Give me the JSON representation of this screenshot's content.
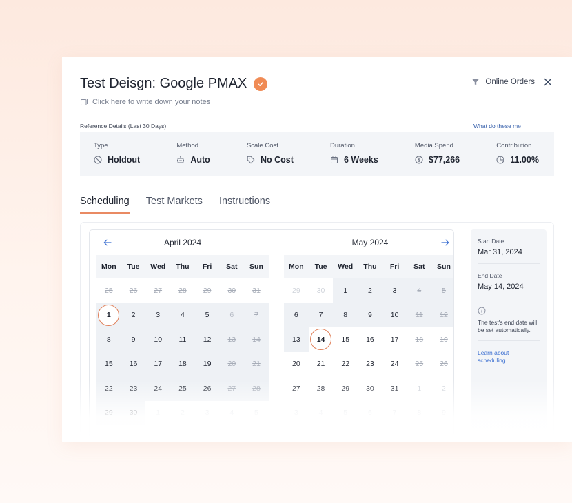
{
  "header": {
    "title": "Test Deisgn: Google PMAX",
    "notes_prompt": "Click here to write down your notes",
    "filter_label": "Online Orders"
  },
  "reference": {
    "label": "Reference Details (Last 30 Days)",
    "link": "What do these me",
    "stats": [
      {
        "label": "Type",
        "value": "Holdout",
        "icon": "ban-icon"
      },
      {
        "label": "Method",
        "value": "Auto",
        "icon": "robot-icon"
      },
      {
        "label": "Scale Cost",
        "value": "No Cost",
        "icon": "tag-icon"
      },
      {
        "label": "Duration",
        "value": "6 Weeks",
        "icon": "calendar-icon"
      },
      {
        "label": "Media Spend",
        "value": "$77,266",
        "icon": "dollar-icon"
      },
      {
        "label": "Contribution",
        "value": "11.00%",
        "icon": "pie-icon"
      }
    ]
  },
  "tabs": [
    {
      "label": "Scheduling",
      "active": true
    },
    {
      "label": "Test Markets",
      "active": false
    },
    {
      "label": "Instructions",
      "active": false
    }
  ],
  "calendar": {
    "weekdays": [
      "Mon",
      "Tue",
      "Wed",
      "Thu",
      "Fri",
      "Sat",
      "Sun"
    ],
    "months": [
      {
        "title": "April 2024",
        "days": [
          {
            "d": "25",
            "s": "struck"
          },
          {
            "d": "26",
            "s": "struck"
          },
          {
            "d": "27",
            "s": "struck"
          },
          {
            "d": "28",
            "s": "struck"
          },
          {
            "d": "29",
            "s": "struck"
          },
          {
            "d": "30",
            "s": "struck"
          },
          {
            "d": "31",
            "s": "struck"
          },
          {
            "d": "1",
            "s": "selected",
            "r": true
          },
          {
            "d": "2",
            "r": true
          },
          {
            "d": "3",
            "r": true
          },
          {
            "d": "4",
            "r": true
          },
          {
            "d": "5",
            "r": true
          },
          {
            "d": "6",
            "s": "muted",
            "r": true
          },
          {
            "d": "7",
            "s": "struck",
            "r": true
          },
          {
            "d": "8",
            "r": true
          },
          {
            "d": "9",
            "r": true
          },
          {
            "d": "10",
            "r": true
          },
          {
            "d": "11",
            "r": true
          },
          {
            "d": "12",
            "r": true
          },
          {
            "d": "13",
            "s": "struck",
            "r": true
          },
          {
            "d": "14",
            "s": "struck",
            "r": true
          },
          {
            "d": "15",
            "r": true
          },
          {
            "d": "16",
            "r": true
          },
          {
            "d": "17",
            "r": true
          },
          {
            "d": "18",
            "r": true
          },
          {
            "d": "19",
            "r": true
          },
          {
            "d": "20",
            "s": "struck",
            "r": true
          },
          {
            "d": "21",
            "s": "struck",
            "r": true
          },
          {
            "d": "22",
            "r": true
          },
          {
            "d": "23",
            "r": true
          },
          {
            "d": "24",
            "r": true
          },
          {
            "d": "25",
            "r": true
          },
          {
            "d": "26",
            "r": true
          },
          {
            "d": "27",
            "s": "struck",
            "r": true
          },
          {
            "d": "28",
            "s": "struck",
            "r": true
          },
          {
            "d": "29",
            "r": true
          },
          {
            "d": "30",
            "r": true
          },
          {
            "d": "1",
            "s": "outside"
          },
          {
            "d": "2",
            "s": "outside"
          },
          {
            "d": "3",
            "s": "outside"
          },
          {
            "d": "4",
            "s": "outside"
          },
          {
            "d": "5",
            "s": "outside"
          }
        ]
      },
      {
        "title": "May 2024",
        "days": [
          {
            "d": "29",
            "s": "outside"
          },
          {
            "d": "30",
            "s": "outside"
          },
          {
            "d": "1",
            "r": true
          },
          {
            "d": "2",
            "r": true
          },
          {
            "d": "3",
            "r": true
          },
          {
            "d": "4",
            "s": "struck",
            "r": true
          },
          {
            "d": "5",
            "s": "struck",
            "r": true
          },
          {
            "d": "6",
            "r": true
          },
          {
            "d": "7",
            "r": true
          },
          {
            "d": "8",
            "r": true
          },
          {
            "d": "9",
            "r": true
          },
          {
            "d": "10",
            "r": true
          },
          {
            "d": "11",
            "s": "struck",
            "r": true
          },
          {
            "d": "12",
            "s": "struck",
            "r": true
          },
          {
            "d": "13",
            "r": true
          },
          {
            "d": "14",
            "s": "selected"
          },
          {
            "d": "15"
          },
          {
            "d": "16"
          },
          {
            "d": "17"
          },
          {
            "d": "18",
            "s": "struck"
          },
          {
            "d": "19",
            "s": "struck"
          },
          {
            "d": "20"
          },
          {
            "d": "21"
          },
          {
            "d": "22"
          },
          {
            "d": "23"
          },
          {
            "d": "24"
          },
          {
            "d": "25",
            "s": "struck"
          },
          {
            "d": "26",
            "s": "struck"
          },
          {
            "d": "27"
          },
          {
            "d": "28"
          },
          {
            "d": "29"
          },
          {
            "d": "30"
          },
          {
            "d": "31"
          },
          {
            "d": "1",
            "s": "outside"
          },
          {
            "d": "2",
            "s": "outside"
          },
          {
            "d": "3",
            "s": "outside"
          },
          {
            "d": "4",
            "s": "outside"
          },
          {
            "d": "5",
            "s": "outside"
          },
          {
            "d": "6",
            "s": "outside"
          },
          {
            "d": "7",
            "s": "outside"
          },
          {
            "d": "8",
            "s": "outside"
          },
          {
            "d": "9",
            "s": "outside"
          }
        ]
      }
    ]
  },
  "side": {
    "start_label": "Start Date",
    "start_value": "Mar 31, 2024",
    "end_label": "End Date",
    "end_value": "May 14, 2024",
    "end_note": "The test's end date will be set automatically.",
    "learn_link": "Learn about scheduling."
  },
  "colors": {
    "accent": "#e98a63",
    "link": "#3b6fd1",
    "verified_badge": "#f08b55"
  }
}
